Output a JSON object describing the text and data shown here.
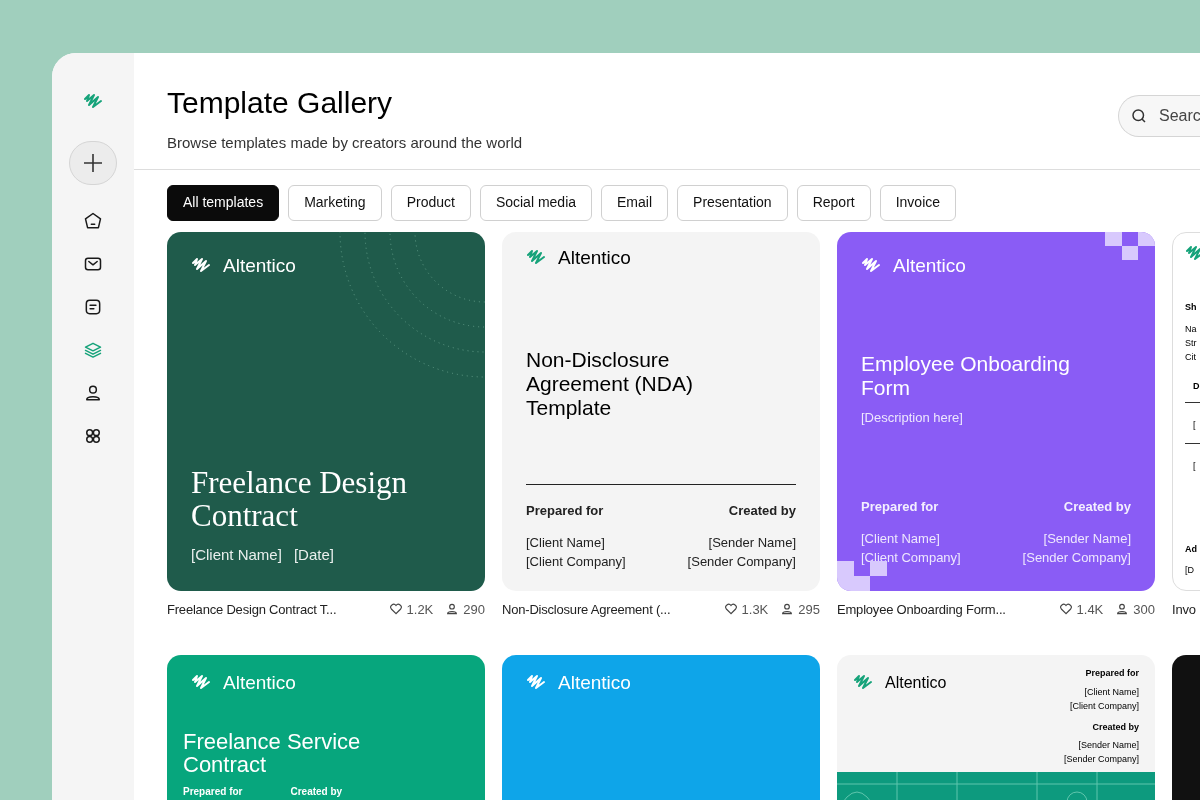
{
  "sidebar": {
    "nav": [
      {
        "kind": "home",
        "selected": false
      },
      {
        "kind": "mail",
        "selected": false
      },
      {
        "kind": "notes",
        "selected": false
      },
      {
        "kind": "layers",
        "selected": true
      },
      {
        "kind": "user",
        "selected": false
      },
      {
        "kind": "apps",
        "selected": false
      }
    ]
  },
  "header": {
    "title": "Template Gallery",
    "subtitle": "Browse templates made by creators around the world",
    "search": {
      "placeholder": "Searc"
    }
  },
  "filters": [
    {
      "label": "All templates",
      "selected": true
    },
    {
      "label": "Marketing",
      "selected": false
    },
    {
      "label": "Product",
      "selected": false
    },
    {
      "label": "Social media",
      "selected": false
    },
    {
      "label": "Email",
      "selected": false
    },
    {
      "label": "Presentation",
      "selected": false
    },
    {
      "label": "Report",
      "selected": false
    },
    {
      "label": "Invoice",
      "selected": false
    }
  ],
  "rows": [
    {
      "cards": [
        {
          "kind": "serif",
          "brand": "Altentico",
          "title": "Freelance Design Contract",
          "details": [
            "[Client Name]",
            "[Date]"
          ],
          "caption": {
            "name": "Freelance Design Contract T...",
            "likes": "1.2K",
            "users": "290"
          }
        },
        {
          "kind": "nda",
          "brand": "Altentico",
          "title": "Non-Disclosure Agreement (NDA) Template",
          "prepared_label": "Prepared for",
          "created_label": "Created by",
          "client_lines": [
            "[Client Name]",
            "[Client Company]"
          ],
          "sender_lines": [
            "[Sender Name]",
            "[Sender Company]"
          ],
          "caption": {
            "name": "Non-Disclosure Agreement (...",
            "likes": "1.3K",
            "users": "295"
          }
        },
        {
          "kind": "onboarding",
          "brand": "Altentico",
          "title": "Employee Onboarding Form",
          "description": "[Description here]",
          "prepared_label": "Prepared for",
          "created_label": "Created by",
          "client_lines": [
            "[Client Name]",
            "[Client Company]"
          ],
          "sender_lines": [
            "[Sender Name]",
            "[Sender Company]"
          ],
          "caption": {
            "name": "Employee Onboarding Form...",
            "likes": "1.4K",
            "users": "300"
          }
        },
        {
          "kind": "invoice",
          "heading": "Sh",
          "lines": [
            "Na",
            "Str",
            "Cit"
          ],
          "table_head": "D",
          "table_cells": [
            "[",
            "["
          ],
          "footer_label": "Ad",
          "footer_value": "[D",
          "caption": {
            "name": "Invo"
          }
        }
      ]
    },
    {
      "cards": [
        {
          "kind": "service",
          "brand": "Altentico",
          "title": "Freelance Service Contract",
          "prepared_label": "Prepared for",
          "created_label": "Created by"
        },
        {
          "kind": "blank",
          "brand": "Altentico"
        },
        {
          "kind": "summary",
          "brand": "Altentico",
          "prepared_label": "Prepared for",
          "client_lines": [
            "[Client Name]",
            "[Client Company]"
          ],
          "created_label": "Created by",
          "sender_lines": [
            "[Sender Name]",
            "[Sender Company]"
          ]
        },
        {
          "kind": "dark"
        }
      ]
    }
  ]
}
